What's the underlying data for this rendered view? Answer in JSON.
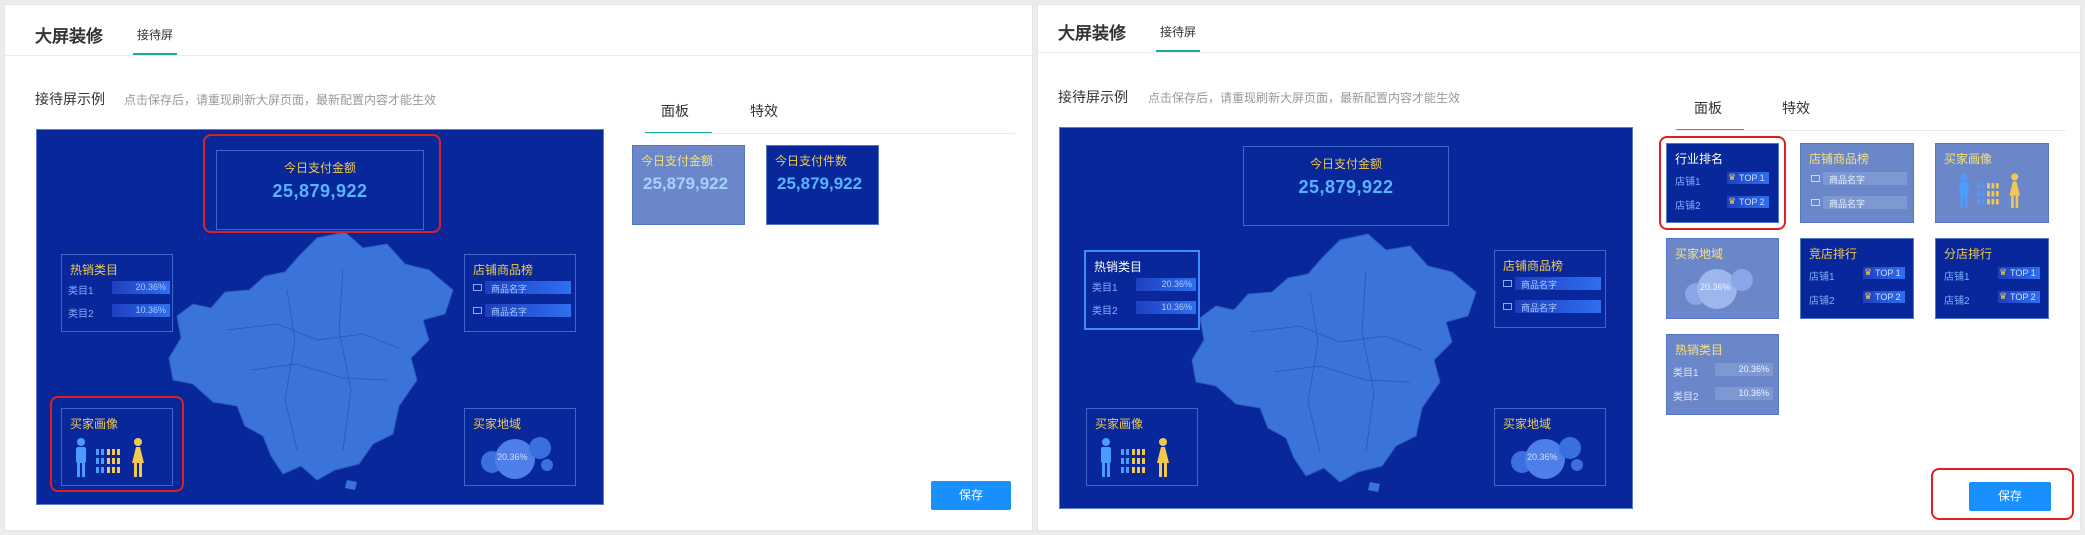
{
  "left": {
    "header": {
      "title": "大屏装修",
      "tab": "接待屏"
    },
    "section": {
      "title": "接待屏示例",
      "hint": "点击保存后，请重现刷新大屏页面，最新配置内容才能生效"
    },
    "screen": {
      "pay": {
        "title": "今日支付金额",
        "value": "25,879,922"
      },
      "hot": {
        "title": "热销类目",
        "rows": [
          {
            "label": "类目1",
            "value": "20.36%"
          },
          {
            "label": "类目2",
            "value": "10.36%"
          }
        ]
      },
      "shop": {
        "title": "店铺商品榜",
        "rows": [
          {
            "label": "商品名字"
          },
          {
            "label": "商品名字"
          }
        ]
      },
      "buyer": {
        "title": "买家画像"
      },
      "region": {
        "title": "买家地域",
        "value": "20.36%"
      }
    },
    "tabs": {
      "panel": "面板",
      "effect": "特效"
    },
    "cards": [
      {
        "title": "今日支付金额",
        "value": "25,879,922"
      },
      {
        "title": "今日支付件数",
        "value": "25,879,922"
      }
    ],
    "save": "保存"
  },
  "right": {
    "header": {
      "title": "大屏装修",
      "tab": "接待屏"
    },
    "section": {
      "title": "接待屏示例",
      "hint": "点击保存后，请重现刷新大屏页面，最新配置内容才能生效"
    },
    "screen": {
      "pay": {
        "title": "今日支付金额",
        "value": "25,879,922"
      },
      "hot": {
        "title": "热销类目",
        "rows": [
          {
            "label": "类目1",
            "value": "20.36%"
          },
          {
            "label": "类目2",
            "value": "10.36%"
          }
        ]
      },
      "shop": {
        "title": "店铺商品榜",
        "rows": [
          {
            "label": "商品名字"
          },
          {
            "label": "商品名字"
          }
        ]
      },
      "buyer": {
        "title": "买家画像"
      },
      "region": {
        "title": "买家地域",
        "value": "20.36%"
      }
    },
    "tabs": {
      "panel": "面板",
      "effect": "特效"
    },
    "cards": {
      "industry": {
        "title": "行业排名",
        "rows": [
          {
            "label": "店铺1",
            "badge": "TOP 1"
          },
          {
            "label": "店铺2",
            "badge": "TOP 2"
          }
        ]
      },
      "shop": {
        "title": "店铺商品榜",
        "rows": [
          {
            "label": "商品名字"
          },
          {
            "label": "商品名字"
          }
        ]
      },
      "buyer": {
        "title": "买家画像"
      },
      "region": {
        "title": "买家地域",
        "value": "20.36%"
      },
      "rival": {
        "title": "竞店排行",
        "rows": [
          {
            "label": "店铺1",
            "badge": "TOP 1"
          },
          {
            "label": "店铺2",
            "badge": "TOP 2"
          }
        ]
      },
      "branch": {
        "title": "分店排行",
        "rows": [
          {
            "label": "店铺1",
            "badge": "TOP 1"
          },
          {
            "label": "店铺2",
            "badge": "TOP 2"
          }
        ]
      },
      "hot": {
        "title": "热销类目",
        "rows": [
          {
            "label": "类目1",
            "value": "20.36%"
          },
          {
            "label": "类目2",
            "value": "10.36%"
          }
        ]
      }
    },
    "save": "保存"
  },
  "colors": {
    "screen_bg": "#07279a",
    "accent_teal": "#1aa99b",
    "save_blue": "#1890ff",
    "highlight_red": "#e02020",
    "gold": "#f2c94c"
  },
  "icons": {
    "crown": "crown-icon",
    "male": "male-figure-icon",
    "female": "female-figure-icon",
    "product": "image-thumbnail-icon"
  }
}
